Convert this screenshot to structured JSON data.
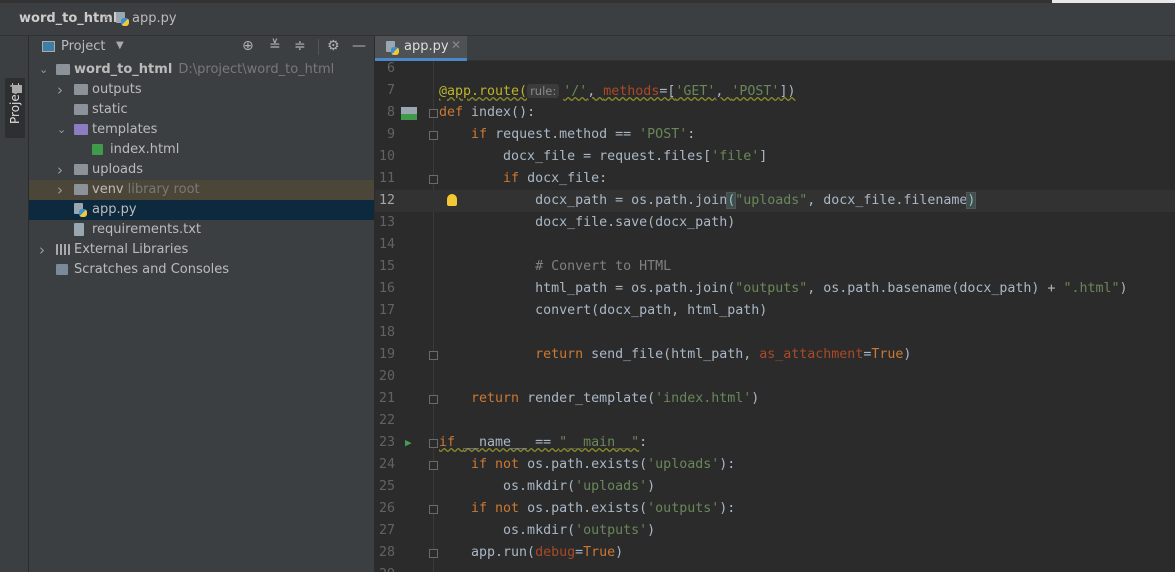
{
  "breadcrumb": {
    "project": "word_to_html",
    "file": "app.py"
  },
  "stripe": {
    "label": "Project"
  },
  "panel": {
    "title": "Project",
    "tools": [
      "locate-icon",
      "expand-all-icon",
      "collapse-all-icon",
      "gear-icon",
      "minimize-icon"
    ]
  },
  "tree": [
    {
      "label": "word_to_html",
      "hint": "D:\\project\\word_to_html",
      "depth": 0,
      "arrow": "down",
      "icon": "folder",
      "bold": true
    },
    {
      "label": "outputs",
      "depth": 1,
      "arrow": "right",
      "icon": "folder"
    },
    {
      "label": "static",
      "depth": 1,
      "arrow": "",
      "icon": "folder"
    },
    {
      "label": "templates",
      "depth": 1,
      "arrow": "down",
      "icon": "folder-purple"
    },
    {
      "label": "index.html",
      "depth": 2,
      "arrow": "",
      "icon": "html"
    },
    {
      "label": "uploads",
      "depth": 1,
      "arrow": "right",
      "icon": "folder"
    },
    {
      "label": "venv",
      "hint": "library root",
      "depth": 1,
      "arrow": "right",
      "icon": "folder",
      "state": "excluded"
    },
    {
      "label": "app.py",
      "depth": 1,
      "arrow": "",
      "icon": "python",
      "state": "selected"
    },
    {
      "label": "requirements.txt",
      "depth": 1,
      "arrow": "",
      "icon": "text"
    },
    {
      "label": "External Libraries",
      "depth": 0,
      "arrow": "right",
      "icon": "libraries"
    },
    {
      "label": "Scratches and Consoles",
      "depth": 0,
      "arrow": "",
      "icon": "scratches"
    }
  ],
  "editor": {
    "tab": "app.py",
    "current_line": 12,
    "lines": [
      {
        "n": 6,
        "t": []
      },
      {
        "n": 7,
        "t": [
          [
            "dec",
            "@app.route(",
            1
          ],
          [
            "hint",
            "rule:"
          ],
          [
            "str",
            "'/'",
            1
          ],
          [
            "id",
            ", ",
            1
          ],
          [
            "par",
            "methods",
            1
          ],
          [
            "id",
            "=[",
            1
          ],
          [
            "str",
            "'GET'",
            1
          ],
          [
            "id",
            ", ",
            1
          ],
          [
            "str",
            "'POST'",
            1
          ],
          [
            "id",
            "])",
            1
          ]
        ]
      },
      {
        "n": 8,
        "t": [
          [
            "kw",
            "def "
          ],
          [
            "id",
            "index():"
          ]
        ],
        "fold": 1,
        "html": 1
      },
      {
        "n": 9,
        "t": [
          [
            "id",
            "    "
          ],
          [
            "kw",
            "if "
          ],
          [
            "id",
            "request.method == "
          ],
          [
            "str",
            "'POST'"
          ],
          [
            "id",
            ":"
          ]
        ],
        "fold": 1
      },
      {
        "n": 10,
        "t": [
          [
            "id",
            "        docx_file = request.files["
          ],
          [
            "str",
            "'file'"
          ],
          [
            "id",
            "]"
          ]
        ]
      },
      {
        "n": 11,
        "t": [
          [
            "id",
            "        "
          ],
          [
            "kw",
            "if "
          ],
          [
            "id",
            "docx_file:"
          ]
        ],
        "fold": 1
      },
      {
        "n": 12,
        "t": [
          [
            "id",
            "            docx_path = os.path.join"
          ],
          [
            "brace",
            "("
          ],
          [
            "str",
            "\"uploads\""
          ],
          [
            "id",
            ", docx_file.filename"
          ],
          [
            "brace",
            ")"
          ]
        ],
        "bulb": 1
      },
      {
        "n": 13,
        "t": [
          [
            "id",
            "            docx_file.save(docx_path)"
          ]
        ]
      },
      {
        "n": 14,
        "t": []
      },
      {
        "n": 15,
        "t": [
          [
            "cmt",
            "            # Convert to HTML"
          ]
        ]
      },
      {
        "n": 16,
        "t": [
          [
            "id",
            "            html_path = os.path.join("
          ],
          [
            "str",
            "\"outputs\""
          ],
          [
            "id",
            ", os.path.basename(docx_path) + "
          ],
          [
            "str",
            "\".html\""
          ],
          [
            "id",
            ")"
          ]
        ]
      },
      {
        "n": 17,
        "t": [
          [
            "id",
            "            convert(docx_path, html_path)"
          ]
        ]
      },
      {
        "n": 18,
        "t": []
      },
      {
        "n": 19,
        "t": [
          [
            "id",
            "            "
          ],
          [
            "kw",
            "return "
          ],
          [
            "id",
            "send_file(html_path, "
          ],
          [
            "par",
            "as_attachment"
          ],
          [
            "id",
            "="
          ],
          [
            "kw",
            "True"
          ],
          [
            "id",
            ")"
          ]
        ],
        "fold": 1
      },
      {
        "n": 20,
        "t": []
      },
      {
        "n": 21,
        "t": [
          [
            "id",
            "    "
          ],
          [
            "kw",
            "return "
          ],
          [
            "id",
            "render_template("
          ],
          [
            "str",
            "'index.html'"
          ],
          [
            "id",
            ")"
          ]
        ],
        "fold": 1
      },
      {
        "n": 22,
        "t": []
      },
      {
        "n": 23,
        "t": [
          [
            "kw",
            "if ",
            1
          ],
          [
            "id",
            "__name__ == ",
            1
          ],
          [
            "str",
            "\"__main__\"",
            1
          ],
          [
            "id",
            ":"
          ]
        ],
        "run": 1,
        "fold": 1
      },
      {
        "n": 24,
        "t": [
          [
            "id",
            "    "
          ],
          [
            "kw",
            "if not "
          ],
          [
            "id",
            "os.path.exists("
          ],
          [
            "str",
            "'uploads'"
          ],
          [
            "id",
            "):"
          ]
        ],
        "fold": 1
      },
      {
        "n": 25,
        "t": [
          [
            "id",
            "        os.mkdir("
          ],
          [
            "str",
            "'uploads'"
          ],
          [
            "id",
            ")"
          ]
        ]
      },
      {
        "n": 26,
        "t": [
          [
            "id",
            "    "
          ],
          [
            "kw",
            "if not "
          ],
          [
            "id",
            "os.path.exists("
          ],
          [
            "str",
            "'outputs'"
          ],
          [
            "id",
            "):"
          ]
        ],
        "fold": 1
      },
      {
        "n": 27,
        "t": [
          [
            "id",
            "        os.mkdir("
          ],
          [
            "str",
            "'outputs'"
          ],
          [
            "id",
            ")"
          ]
        ]
      },
      {
        "n": 28,
        "t": [
          [
            "id",
            "    app.run("
          ],
          [
            "par",
            "debug"
          ],
          [
            "id",
            "="
          ],
          [
            "kw",
            "True"
          ],
          [
            "id",
            ")"
          ]
        ],
        "fold": 1
      },
      {
        "n": 29,
        "t": []
      }
    ]
  },
  "colors": {
    "keyword": "#cc7832",
    "string": "#6a8759",
    "decorator": "#bbb529",
    "identifier": "#a9b7c6",
    "selection": "#0d293e",
    "accent": "#4a88c7"
  }
}
